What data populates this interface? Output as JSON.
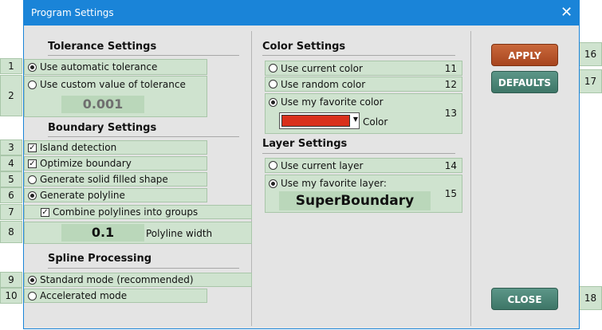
{
  "window": {
    "title": "Program Settings",
    "close_glyph": "✕"
  },
  "tolerance": {
    "title": "Tolerance Settings",
    "auto_label": "Use automatic tolerance",
    "custom_label": "Use custom value of tolerance",
    "custom_value": "0.001",
    "selected": "auto"
  },
  "boundary": {
    "title": "Boundary Settings",
    "island_label": "Island detection",
    "optimize_label": "Optimize boundary",
    "solid_label": "Generate solid filled shape",
    "polyline_label": "Generate polyline",
    "combine_label": "Combine polylines into groups",
    "width_value": "0.1",
    "width_label": "Polyline width"
  },
  "spline": {
    "title": "Spline Processing",
    "standard_label": "Standard mode (recommended)",
    "accelerated_label": "Accelerated mode"
  },
  "color": {
    "title": "Color Settings",
    "current_label": "Use current color",
    "random_label": "Use random color",
    "favorite_label": "Use my favorite color",
    "swatch_label": "Color",
    "swatch_color": "#d9301c"
  },
  "layer": {
    "title": "Layer Settings",
    "current_label": "Use current layer",
    "favorite_label": "Use my favorite layer:",
    "favorite_value": "SuperBoundary"
  },
  "buttons": {
    "apply": "APPLY",
    "defaults": "DEFAULTS",
    "close": "CLOSE"
  },
  "markers": {
    "m1": "1",
    "m2": "2",
    "m3": "3",
    "m4": "4",
    "m5": "5",
    "m6": "6",
    "m7": "7",
    "m8": "8",
    "m9": "9",
    "m10": "10",
    "m11": "11",
    "m12": "12",
    "m13": "13",
    "m14": "14",
    "m15": "15",
    "m16": "16",
    "m17": "17",
    "m18": "18"
  }
}
